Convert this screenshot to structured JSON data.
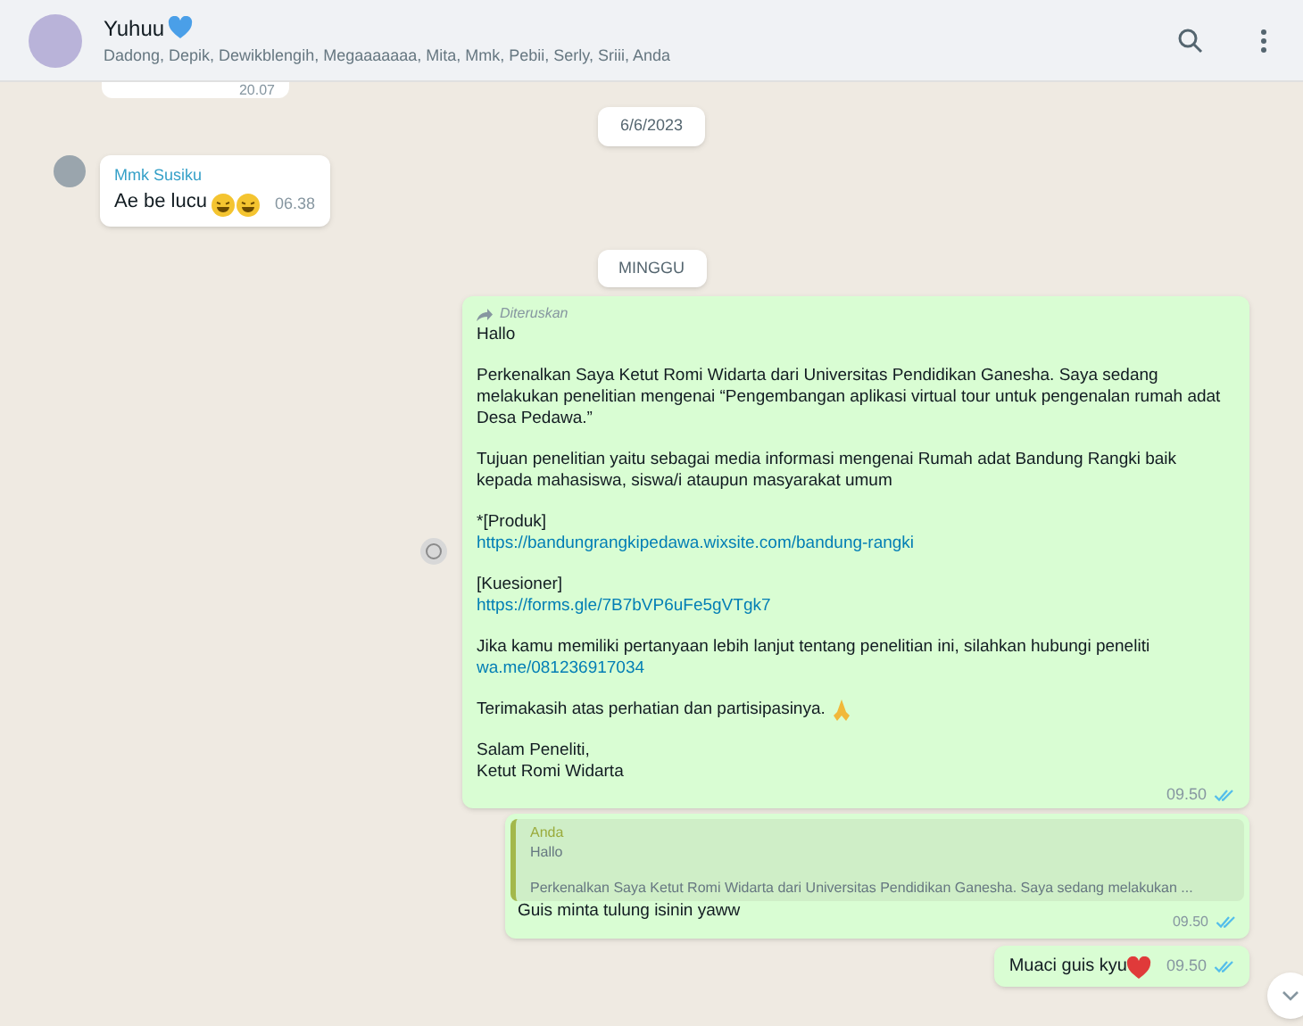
{
  "header": {
    "title": "Yuhuu",
    "members": "Dadong, Depik, Dewikblengih, Megaaaaaaa, Mita, Mmk, Pebii, Serly, Sriii, Anda"
  },
  "messages": [
    {
      "kind": "cut",
      "time": "20.07"
    },
    {
      "kind": "date",
      "text": "6/6/2023"
    },
    {
      "kind": "incoming",
      "sender": "Mmk Susiku",
      "text": "Ae be lucu",
      "time": "06.38"
    },
    {
      "kind": "date",
      "text": "MINGGU"
    },
    {
      "kind": "forwarded",
      "label": "Diteruskan",
      "time": "09.50",
      "read": true,
      "parts": [
        {
          "kind": "text",
          "text": "Hallo"
        },
        {
          "kind": "gap"
        },
        {
          "kind": "text",
          "text": "Perkenalkan Saya Ketut Romi Widarta dari Universitas Pendidikan Ganesha. Saya sedang melakukan penelitian mengenai “Pengembangan aplikasi virtual tour untuk pengenalan rumah adat Desa Pedawa.”"
        },
        {
          "kind": "gap"
        },
        {
          "kind": "text",
          "text": "Tujuan penelitian yaitu sebagai media informasi mengenai Rumah adat Bandung Rangki baik kepada mahasiswa, siswa/i ataupun masyarakat umum"
        },
        {
          "kind": "gap"
        },
        {
          "kind": "text",
          "text": "*[Produk]"
        },
        {
          "kind": "link",
          "text": "https://bandungrangkipedawa.wixsite.com/bandung-rangki"
        },
        {
          "kind": "gap"
        },
        {
          "kind": "text",
          "text": "[Kuesioner]"
        },
        {
          "kind": "link",
          "text": "https://forms.gle/7B7bVP6uFe5gVTgk7"
        },
        {
          "kind": "gap"
        },
        {
          "kind": "text",
          "text": "Jika kamu memiliki pertanyaan lebih lanjut tentang penelitian ini, silahkan hubungi peneliti"
        },
        {
          "kind": "link",
          "text": "wa.me/081236917034"
        },
        {
          "kind": "gap"
        },
        {
          "kind": "thanks",
          "text": "Terimakasih atas perhatian dan partisipasinya."
        },
        {
          "kind": "gap"
        },
        {
          "kind": "text",
          "text": "Salam Peneliti,"
        },
        {
          "kind": "text",
          "text": "Ketut Romi Widarta"
        }
      ]
    },
    {
      "kind": "reply",
      "quote_author": "Anda",
      "quote_first": "Hallo",
      "quote_rest": "Perkenalkan Saya Ketut Romi Widarta dari Universitas Pendidikan Ganesha. Saya sedang melakukan ...",
      "text": "Guis minta tulung isinin yaww",
      "time": "09.50",
      "read": true
    },
    {
      "kind": "outgoing",
      "text": "Muaci guis kyu",
      "time": "09.50",
      "read": true
    }
  ]
}
